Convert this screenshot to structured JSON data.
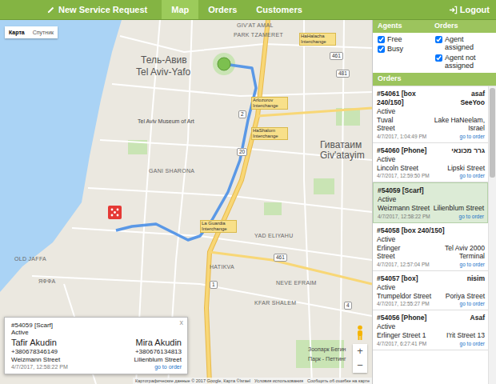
{
  "nav": {
    "items": [
      {
        "label": "New Service Request",
        "kind": "action",
        "selected": false
      },
      {
        "label": "Map",
        "kind": "tab",
        "selected": true
      },
      {
        "label": "Orders",
        "kind": "tab",
        "selected": false
      },
      {
        "label": "Customers",
        "kind": "tab",
        "selected": false
      }
    ],
    "logout": "Logout"
  },
  "map": {
    "type_buttons": [
      {
        "label": "Карта",
        "selected": true
      },
      {
        "label": "Спутник",
        "selected": false
      }
    ],
    "labels": [
      {
        "text": "GIV'AT AMAL",
        "kind": "area"
      },
      {
        "text": "PARK TZAMERET",
        "kind": "area"
      },
      {
        "text": "HaHalacha Interchange",
        "kind": "interchange"
      },
      {
        "text": "Тель-Авив",
        "kind": "city"
      },
      {
        "text": "Tel Aviv-Yafo",
        "kind": "city"
      },
      {
        "text": "Arlozorov Interchange",
        "kind": "interchange"
      },
      {
        "text": "Tel Aviv Museum of Art",
        "kind": "poi"
      },
      {
        "text": "HaShalom Interchange",
        "kind": "interchange"
      },
      {
        "text": "Гиватаим",
        "kind": "city"
      },
      {
        "text": "Giv'atayim",
        "kind": "city"
      },
      {
        "text": "GANI SHARONA",
        "kind": "area"
      },
      {
        "text": "La Guardia Interchange",
        "kind": "interchange"
      },
      {
        "text": "YAD ELIYAHU",
        "kind": "area"
      },
      {
        "text": "OLD JAFFA",
        "kind": "area"
      },
      {
        "text": "HATIKVA",
        "kind": "area"
      },
      {
        "text": "ЯФФА",
        "kind": "area"
      },
      {
        "text": "NEVE EFRAIM",
        "kind": "area"
      },
      {
        "text": "KFAR SHALEM",
        "kind": "area"
      },
      {
        "text": "Зоопарк Бегин",
        "kind": "poi"
      },
      {
        "text": "Парк - Петтинг",
        "kind": "poi"
      }
    ],
    "road_numbers": [
      "2",
      "20",
      "461",
      "481",
      "461",
      "1",
      "4"
    ],
    "zoom": [
      "+",
      "−"
    ],
    "attribution": [
      "Картографические данные © 2017 Google, Карта ©Israel",
      "Условия использования",
      "Сообщить об ошибке на карте"
    ]
  },
  "popup": {
    "order": "#54059 [Scarf]",
    "status": "Active",
    "customer": "Tafir Akudin",
    "customer_phone": "+380678346149",
    "agent": "Mira Akudin",
    "agent_phone": "+380676134813",
    "from": "Weizmann Street",
    "to": "Lilienblum Street",
    "time": "4/7/2017, 12:58:22 PM",
    "link": "go to order",
    "close": "x"
  },
  "filters": [
    {
      "title": "Agents",
      "options": [
        {
          "label": "Free",
          "checked": true
        },
        {
          "label": "Busy",
          "checked": true
        }
      ]
    },
    {
      "title": "Orders",
      "options": [
        {
          "label": "Agent assigned",
          "checked": true
        },
        {
          "label": "Agent not assigned",
          "checked": true
        }
      ]
    }
  ],
  "orders_panel": {
    "title": "Orders",
    "scrollbar": {
      "level": 0.3
    },
    "orders": [
      {
        "id": "#54061 [box 240/150]",
        "customer": "asaf SeeYoo",
        "status": "Active",
        "from": "Tuval Street",
        "to": "Lake HaNeelam, Israel",
        "time": "4/7/2017, 1:04:49 PM",
        "link": "go to order",
        "selected": false
      },
      {
        "id": "#54060 [Phone]",
        "customer": "גרר מכונאי",
        "status": "Active",
        "from": "Lincoln Street",
        "to": "Lipski Street",
        "time": "4/7/2017, 12:59:50 PM",
        "link": "go to order",
        "selected": false
      },
      {
        "id": "#54059 [Scarf]",
        "customer": "",
        "status": "Active",
        "from": "Weizmann Street",
        "to": "Lilienblum Street",
        "time": "4/7/2017, 12:58:22 PM",
        "link": "go to order",
        "selected": true
      },
      {
        "id": "#54058 [box 240/150]",
        "customer": "",
        "status": "Active",
        "from": "Erlinger Street",
        "to": "Tel Aviv 2000 Terminal",
        "time": "4/7/2017, 12:57:04 PM",
        "link": "go to order",
        "selected": false
      },
      {
        "id": "#54057 [box]",
        "customer": "nisim",
        "status": "Active",
        "from": "Trumpeldor Street",
        "to": "Poriya Street",
        "time": "4/7/2017, 12:55:27 PM",
        "link": "go to order",
        "selected": false
      },
      {
        "id": "#54056 [Phone]",
        "customer": "Asaf",
        "status": "Active",
        "from": "Erlinger Street 1",
        "to": "I'rit Street 13",
        "time": "4/7/2017, 6:27:41 PM",
        "link": "go to order",
        "selected": false
      }
    ]
  }
}
